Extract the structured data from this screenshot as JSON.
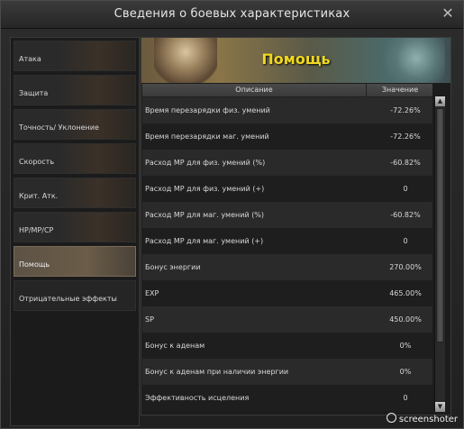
{
  "window": {
    "title": "Сведения о боевых характеристиках",
    "close_glyph": "✕"
  },
  "sidebar": {
    "items": [
      {
        "label": "Атака",
        "active": false
      },
      {
        "label": "Защита",
        "active": false
      },
      {
        "label": "Точность/ Уклонение",
        "active": false
      },
      {
        "label": "Скорость",
        "active": false
      },
      {
        "label": "Крит. Атк.",
        "active": false
      },
      {
        "label": "HP/MP/CP",
        "active": false
      },
      {
        "label": "Помощь",
        "active": true
      },
      {
        "label": "Отрицательные эффекты",
        "active": false
      }
    ]
  },
  "main": {
    "banner_title": "Помощь",
    "table": {
      "col_desc": "Описание",
      "col_value": "Значение",
      "rows": [
        {
          "desc": "Время перезарядки физ. умений",
          "value": "-72.26%"
        },
        {
          "desc": "Время перезарядки маг. умений",
          "value": "-72.26%"
        },
        {
          "desc": "Расход MP для физ. умений (%)",
          "value": "-60.82%"
        },
        {
          "desc": "Расход MP для физ. умений (+)",
          "value": "0"
        },
        {
          "desc": "Расход MP для маг. умений (%)",
          "value": "-60.82%"
        },
        {
          "desc": "Расход MP для маг. умений (+)",
          "value": "0"
        },
        {
          "desc": "Бонус энергии",
          "value": "270.00%"
        },
        {
          "desc": "EXP",
          "value": "465.00%"
        },
        {
          "desc": "SP",
          "value": "450.00%"
        },
        {
          "desc": "Бонус к аденам",
          "value": "0%"
        },
        {
          "desc": "Бонус к аденам при наличии энергии",
          "value": "0%"
        },
        {
          "desc": "Эффективность исцеления",
          "value": "0"
        }
      ]
    },
    "scroll_up": "▲",
    "scroll_down": "▼"
  },
  "watermark": "screenshoter",
  "colors": {
    "banner_title": "#f0d820",
    "active_tab": "#6b5c48"
  }
}
